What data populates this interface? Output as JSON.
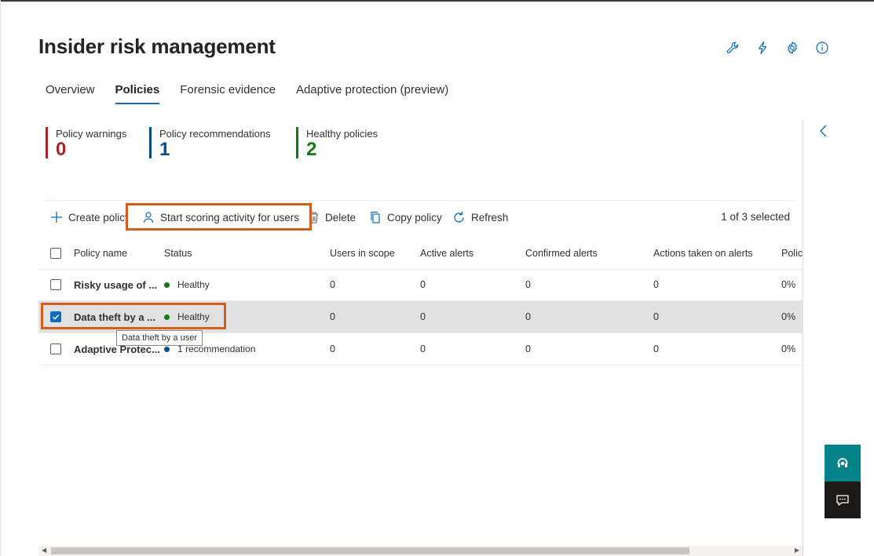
{
  "header": {
    "title": "Insider risk management",
    "icons": [
      "wrench-icon",
      "lightning-icon",
      "settings-icon",
      "info-icon"
    ]
  },
  "tabs": [
    {
      "label": "Overview",
      "active": false
    },
    {
      "label": "Policies",
      "active": true
    },
    {
      "label": "Forensic evidence",
      "active": false
    },
    {
      "label": "Adaptive protection (preview)",
      "active": false
    }
  ],
  "stats": {
    "warnings": {
      "label": "Policy warnings",
      "value": "0",
      "color": "#a4262c"
    },
    "recommendations": {
      "label": "Policy recommendations",
      "value": "1",
      "color": "#004e8c"
    },
    "healthy": {
      "label": "Healthy policies",
      "value": "2",
      "color": "#107c10"
    }
  },
  "toolbar": {
    "create": "Create policy",
    "start_scoring": "Start scoring activity for users",
    "delete": "Delete",
    "copy": "Copy policy",
    "refresh": "Refresh",
    "selected_count": "1 of 3 selected"
  },
  "table": {
    "columns": {
      "name": "Policy name",
      "status": "Status",
      "users": "Users in scope",
      "active": "Active alerts",
      "confirmed": "Confirmed alerts",
      "actions": "Actions taken on alerts",
      "policy": "Policy"
    },
    "rows": [
      {
        "name": "Risky usage of ...",
        "status": "Healthy",
        "status_color": "#107c10",
        "users": "0",
        "active": "0",
        "confirmed": "0",
        "actions": "0",
        "policy": "0%",
        "selected": false
      },
      {
        "name": "Data theft by a ...",
        "status": "Healthy",
        "status_color": "#107c10",
        "users": "0",
        "active": "0",
        "confirmed": "0",
        "actions": "0",
        "policy": "0%",
        "selected": true
      },
      {
        "name": "Adaptive Protec...",
        "status": "1 recommendation",
        "status_color": "#004e8c",
        "users": "0",
        "active": "0",
        "confirmed": "0",
        "actions": "0",
        "policy": "0%",
        "selected": false
      }
    ],
    "tooltip": "Data theft by a user"
  },
  "accent_color": "#0f6cbd",
  "highlight_color": "#d35d1b"
}
